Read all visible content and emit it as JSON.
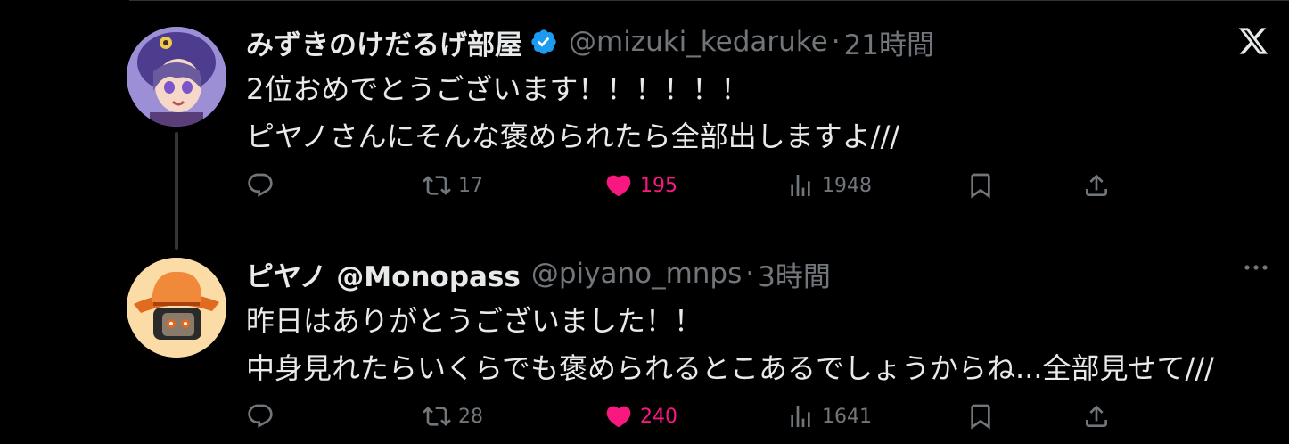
{
  "tweets": [
    {
      "display_name": "みずきのけだるげ部屋",
      "verified": true,
      "handle": "@mizuki_kedaruke",
      "separator": "·",
      "time": "21時間",
      "lines": [
        "2位おめでとうございます！！！！！！",
        "ピヤノさんにそんな褒められたら全部出しますよ///"
      ],
      "replies": "",
      "retweets": "17",
      "likes": "195",
      "views": "1948",
      "liked": true
    },
    {
      "display_name": "ピヤノ @Monopass",
      "verified": false,
      "handle": "@piyano_mnps",
      "separator": "·",
      "time": "3時間",
      "lines": [
        "昨日はありがとうございました！！",
        "中身見れたらいくらでも褒められるとこあるでしょうからね...全部見せて///"
      ],
      "replies": "",
      "retweets": "28",
      "likes": "240",
      "views": "1641",
      "liked": true
    }
  ],
  "icons": {
    "logo": "x-logo-icon",
    "more": "more-icon",
    "verified": "verified-badge-icon",
    "reply": "reply-icon",
    "retweet": "retweet-icon",
    "like": "heart-icon",
    "views": "views-icon",
    "bookmark": "bookmark-icon",
    "share": "share-icon"
  },
  "colors": {
    "background": "#000000",
    "text": "#e7e9ea",
    "muted": "#71767b",
    "like": "#f91880",
    "verified": "#1d9bf0"
  }
}
